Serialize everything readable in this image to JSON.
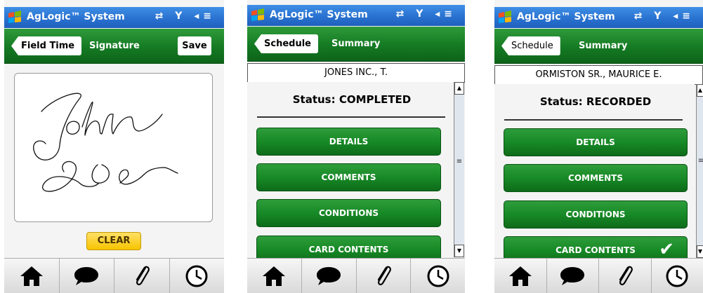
{
  "app": {
    "name": "AgLogic™ System"
  },
  "screens": [
    {
      "header": {
        "back_label": "Field Time",
        "title": "Signature",
        "save_label": "Save"
      },
      "clear_label": "CLEAR"
    },
    {
      "header": {
        "back_label": "Schedule",
        "title": "Summary"
      },
      "customer": "JONES INC., T.",
      "status": "Status: COMPLETED",
      "buttons": [
        "DETAILS",
        "COMMENTS",
        "CONDITIONS",
        "CARD CONTENTS"
      ]
    },
    {
      "header": {
        "back_label": "Schedule",
        "title": "Summary"
      },
      "customer": "ORMISTON SR., MAURICE E.",
      "status": "Status: RECORDED",
      "buttons": [
        "DETAILS",
        "COMMENTS",
        "CONDITIONS",
        "CARD CONTENTS"
      ],
      "card_contents_check": "✔"
    }
  ],
  "bottom_tabs": [
    "home-icon",
    "speech-bubble-icon",
    "paperclip-icon",
    "clock-icon"
  ],
  "colors": {
    "title_bar": "#2b74d2",
    "header_green": "#157a23",
    "button_green": "#178a26",
    "clear_yellow": "#f6c400"
  }
}
